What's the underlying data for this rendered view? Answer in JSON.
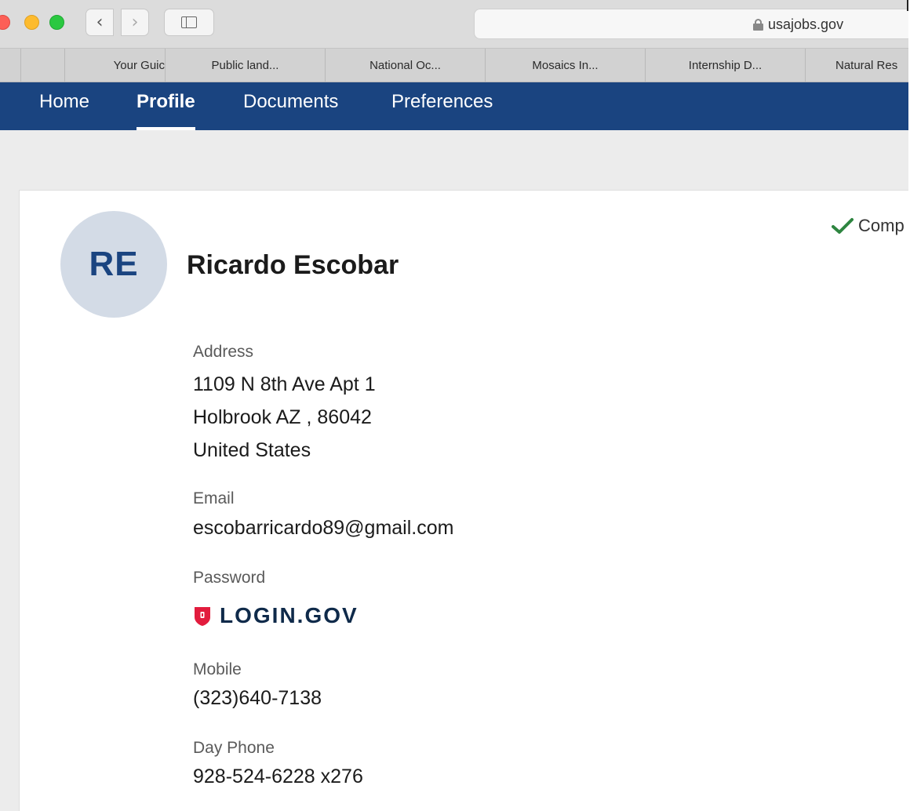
{
  "browser": {
    "url": "usajobs.gov",
    "colors": {
      "red": "#fc5f57",
      "yellow": "#fdbb2e",
      "green": "#2ac840"
    }
  },
  "bookmarks": [
    "",
    "Your Guic",
    "Public land...",
    "National Oc...",
    "Mosaics In...",
    "Internship D...",
    "Natural Res"
  ],
  "nav": {
    "tabs": [
      "Home",
      "Profile",
      "Documents",
      "Preferences"
    ],
    "active": "Profile",
    "color": "#1a4480"
  },
  "profile": {
    "initials": "RE",
    "name": "Ricardo Escobar",
    "status": "Comp",
    "fields": {
      "address_label": "Address",
      "address_line1": "1109 N 8th Ave Apt 1",
      "address_line2": "Holbrook AZ , 86042",
      "address_line3": "United States",
      "email_label": "Email",
      "email": "escobarricardo89@gmail.com",
      "password_label": "Password",
      "password_provider": "LOGIN.GOV",
      "mobile_label": "Mobile",
      "mobile": "(323)640-7138",
      "day_phone_label": "Day Phone",
      "day_phone": "928-524-6228 x276"
    }
  },
  "icons": {
    "lock": "lock-icon",
    "check": "check-icon",
    "shield": "login-gov-shield-icon"
  }
}
